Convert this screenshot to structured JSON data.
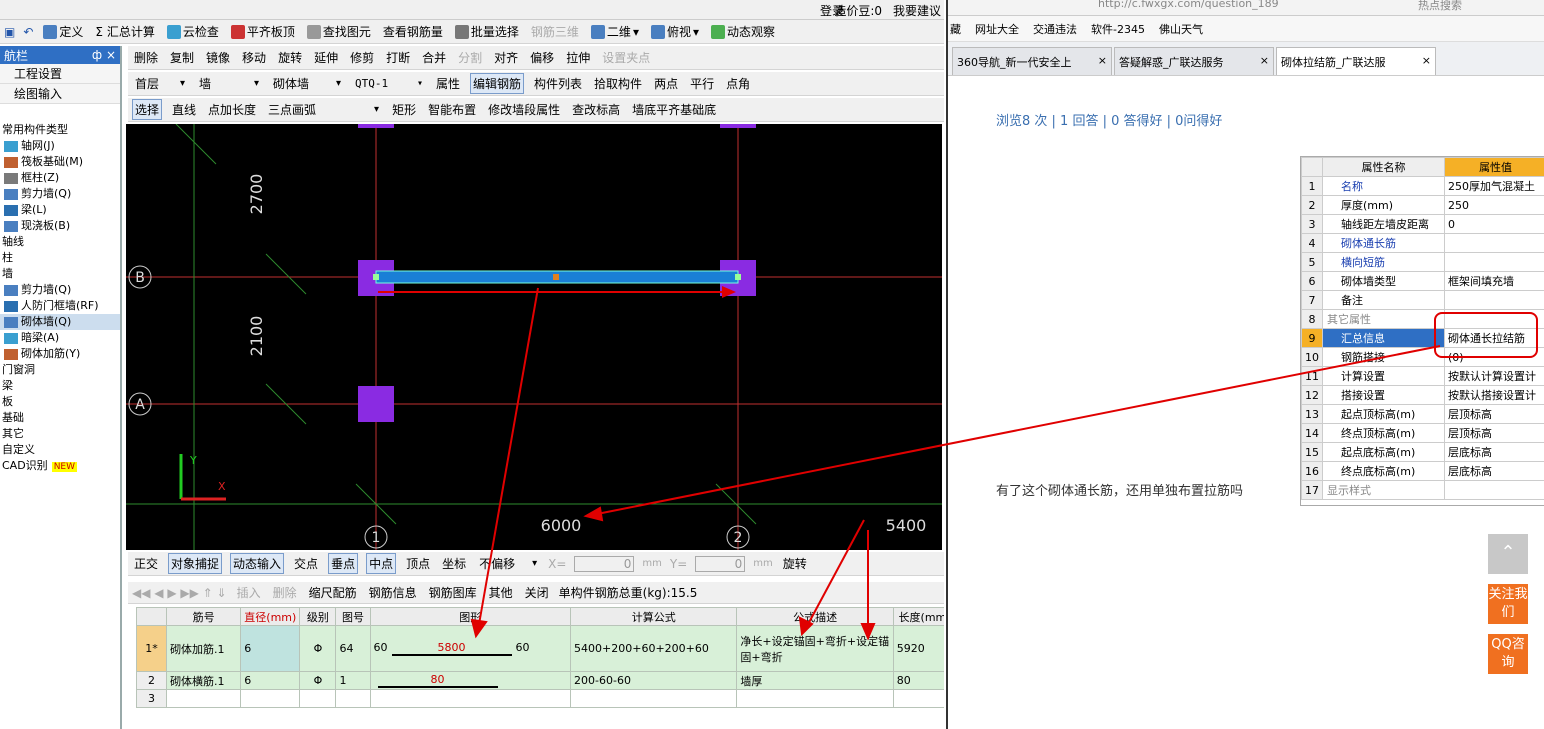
{
  "topbar": {
    "login": "登录",
    "price": "造价豆:0",
    "ask": "我要建议"
  },
  "toolbar1": [
    "定义",
    "Σ 汇总计算",
    "云检查",
    "平齐板顶",
    "查找图元",
    "查看钢筋量",
    "批量选择",
    "钢筋三维",
    "二维",
    "俯视",
    "动态观察"
  ],
  "toolbar2": [
    "删除",
    "复制",
    "镜像",
    "移动",
    "旋转",
    "延伸",
    "修剪",
    "打断",
    "合并",
    "分割",
    "对齐",
    "偏移",
    "拉伸",
    "设置夹点"
  ],
  "toolbar3": {
    "floor": "首层",
    "type": "墙",
    "subtype": "砌体墙",
    "code": "QTQ-1",
    "btns": [
      "属性",
      "编辑钢筋",
      "构件列表",
      "拾取构件",
      "两点",
      "平行",
      "点角"
    ]
  },
  "toolbar4": [
    "选择",
    "直线",
    "点加长度",
    "三点画弧",
    "矩形",
    "智能布置",
    "修改墙段属性",
    "查改标高",
    "墙底平齐基础底"
  ],
  "sidebar": {
    "title": "航栏",
    "pin": "ф",
    "close": "×",
    "btn1": "工程设置",
    "btn2": "绘图输入",
    "items": [
      {
        "label": "常用构件类型",
        "kind": "cat"
      },
      {
        "label": "轴网(J)",
        "kind": "sub"
      },
      {
        "label": "筏板基础(M)",
        "kind": "sub"
      },
      {
        "label": "框柱(Z)",
        "kind": "sub"
      },
      {
        "label": "剪力墙(Q)",
        "kind": "sub"
      },
      {
        "label": "梁(L)",
        "kind": "sub"
      },
      {
        "label": "现浇板(B)",
        "kind": "sub"
      },
      {
        "label": "轴线",
        "kind": "cat"
      },
      {
        "label": "柱",
        "kind": "cat"
      },
      {
        "label": "墙",
        "kind": "cat"
      },
      {
        "label": "剪力墙(Q)",
        "kind": "sub"
      },
      {
        "label": "人防门框墙(RF)",
        "kind": "sub"
      },
      {
        "label": "砌体墙(Q)",
        "kind": "sub",
        "hl": true
      },
      {
        "label": "暗梁(A)",
        "kind": "sub"
      },
      {
        "label": "砌体加筋(Y)",
        "kind": "sub"
      },
      {
        "label": "门窗洞",
        "kind": "cat"
      },
      {
        "label": "梁",
        "kind": "cat"
      },
      {
        "label": "板",
        "kind": "cat"
      },
      {
        "label": "基础",
        "kind": "cat"
      },
      {
        "label": "其它",
        "kind": "cat"
      },
      {
        "label": "自定义",
        "kind": "cat"
      },
      {
        "label": "CAD识别",
        "kind": "cat",
        "badge": "NEW"
      }
    ]
  },
  "canvas": {
    "dim_top": "2700",
    "dim_mid": "2100",
    "axis_b": "B",
    "axis_a": "A",
    "axis_1": "1",
    "axis_2": "2",
    "dim_bottom": "6000",
    "dim_right": "5400",
    "y_label": "Y",
    "x_label": "X"
  },
  "snapbar": [
    "正交",
    "对象捕捉",
    "动态输入",
    "交点",
    "垂点",
    "中点",
    "顶点",
    "坐标",
    "不偏移",
    "X=",
    "0",
    "mm",
    "Y=",
    "0",
    "mm",
    "旋转"
  ],
  "gridbar": {
    "btns": [
      "插入",
      "删除",
      "缩尺配筋",
      "钢筋信息",
      "钢筋图库",
      "其他",
      "关闭"
    ],
    "total": "单构件钢筋总重(kg):15.5"
  },
  "table": {
    "headers": [
      "",
      "筋号",
      "直径(mm)",
      "级别",
      "图号",
      "图形",
      "计算公式",
      "公式描述",
      "长度(mm"
    ],
    "rows": [
      {
        "no": "1*",
        "name": "砌体加筋.1",
        "dia": "6",
        "grade": "Φ",
        "fig": "64",
        "shape_l": "60",
        "shape_mid": "5800",
        "shape_r": "60",
        "formula": "5400+200+60+200+60",
        "desc": "净长+设定锚固+弯折+设定锚固+弯折",
        "len": "5920"
      },
      {
        "no": "2",
        "name": "砌体横筋.1",
        "dia": "6",
        "grade": "Φ",
        "fig": "1",
        "shape_l": "",
        "shape_mid": "80",
        "shape_r": "",
        "formula": "200-60-60",
        "desc": "墙厚",
        "len": "80"
      },
      {
        "no": "3",
        "name": "",
        "dia": "",
        "grade": "",
        "fig": "",
        "shape_l": "",
        "shape_mid": "",
        "shape_r": "",
        "formula": "",
        "desc": "",
        "len": ""
      }
    ]
  },
  "browser": {
    "url": "http://c.fwxgx.com/question_189",
    "search": "热点搜索",
    "bookmarks": [
      "藏",
      "网址大全",
      "交通违法",
      "软件-2345",
      "佛山天气"
    ],
    "tabs": [
      {
        "label": "360导航_新一代安全上"
      },
      {
        "label": "答疑解惑_广联达服务"
      },
      {
        "label": "砌体拉结筋_广联达服"
      }
    ],
    "stats": "浏览8 次 | 1 回答 | 0 答得好 | 0问得好",
    "question": "有了这个砌体通长筋，还用单独布置拉筋吗",
    "follow": "关注我们",
    "qq": "QQ咨询"
  },
  "props": {
    "headers": [
      "属性名称",
      "属性值"
    ],
    "rows": [
      {
        "n": "1",
        "name": "名称",
        "val": "250厚加气混凝土",
        "blue": true
      },
      {
        "n": "2",
        "name": "厚度(mm)",
        "val": "250"
      },
      {
        "n": "3",
        "name": "轴线距左墙皮距离",
        "val": "0"
      },
      {
        "n": "4",
        "name": "砌体通长筋",
        "val": "",
        "blue": true
      },
      {
        "n": "5",
        "name": "横向短筋",
        "val": "",
        "blue": true
      },
      {
        "n": "6",
        "name": "砌体墙类型",
        "val": "框架间填充墙"
      },
      {
        "n": "7",
        "name": "备注",
        "val": ""
      },
      {
        "n": "8",
        "name": "其它属性",
        "val": "",
        "group": true
      },
      {
        "n": "9",
        "name": "汇总信息",
        "val": "砌体通长拉结筋",
        "sel": true
      },
      {
        "n": "10",
        "name": "钢筋搭接",
        "val": "(0)"
      },
      {
        "n": "11",
        "name": "计算设置",
        "val": "按默认计算设置计"
      },
      {
        "n": "12",
        "name": "搭接设置",
        "val": "按默认搭接设置计"
      },
      {
        "n": "13",
        "name": "起点顶标高(m)",
        "val": "层顶标高"
      },
      {
        "n": "14",
        "name": "终点顶标高(m)",
        "val": "层顶标高"
      },
      {
        "n": "15",
        "name": "起点底标高(m)",
        "val": "层底标高"
      },
      {
        "n": "16",
        "name": "终点底标高(m)",
        "val": "层底标高"
      },
      {
        "n": "17",
        "name": "显示样式",
        "val": "",
        "group": true
      }
    ]
  },
  "colors": {
    "annot": "#e00000",
    "axis": "#2e8b2e",
    "wall": "#1a7fd6",
    "col": "#8a2be2",
    "accent": "#f07020"
  }
}
